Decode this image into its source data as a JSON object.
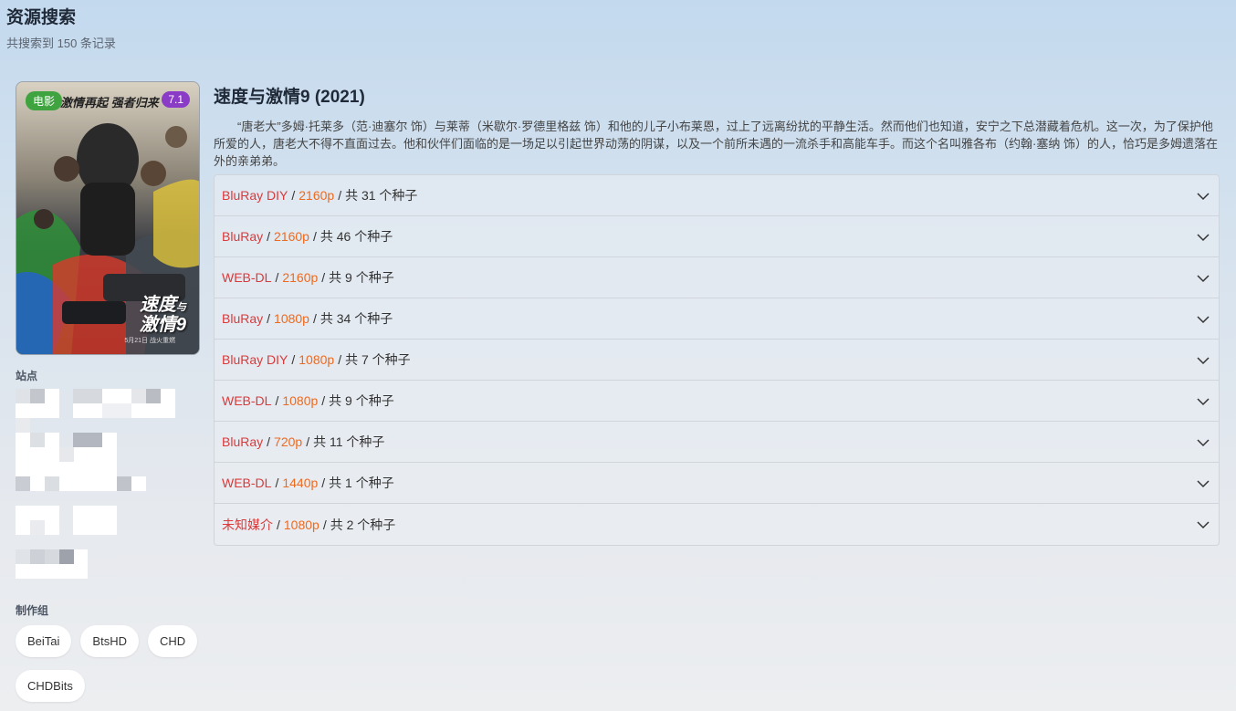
{
  "header": {
    "title": "资源搜索",
    "subtitle": "共搜索到 150 条记录"
  },
  "poster": {
    "type_badge": "电影",
    "rating": "7.1",
    "tagline": "激情再起 强者归来",
    "logo_line1": "速度",
    "logo_small": "与",
    "logo_line2": "激情9",
    "date_text": "5月21日 战火重燃"
  },
  "sidebar": {
    "site_label": "站点",
    "group_label": "制作组",
    "groups": [
      "BeiTai",
      "BtsHD",
      "CHD",
      "CHDBits"
    ]
  },
  "movie": {
    "title": "速度与激情9 (2021)",
    "overview": "“唐老大”多姆·托莱多（范·迪塞尔 饰）与莱蒂（米歇尔·罗德里格兹 饰）和他的儿子小布莱恩，过上了远离纷扰的平静生活。然而他们也知道，安宁之下总潜藏着危机。这一次，为了保护他所爱的人，唐老大不得不直面过去。他和伙伴们面临的是一场足以引起世界动荡的阴谋，以及一个前所未遇的一流杀手和高能车手。而这个名叫雅各布（约翰·塞纳 饰）的人，恰巧是多姆遗落在外的亲弟弟。"
  },
  "releases": [
    {
      "source": "BluRay DIY",
      "resolution": "2160p",
      "count": "共 31 个种子"
    },
    {
      "source": "BluRay",
      "resolution": "2160p",
      "count": "共 46 个种子"
    },
    {
      "source": "WEB-DL",
      "resolution": "2160p",
      "count": "共 9 个种子"
    },
    {
      "source": "BluRay",
      "resolution": "1080p",
      "count": "共 34 个种子"
    },
    {
      "source": "BluRay DIY",
      "resolution": "1080p",
      "count": "共 7 个种子"
    },
    {
      "source": "WEB-DL",
      "resolution": "1080p",
      "count": "共 9 个种子"
    },
    {
      "source": "BluRay",
      "resolution": "720p",
      "count": "共 11 个种子"
    },
    {
      "source": "WEB-DL",
      "resolution": "1440p",
      "count": "共 1 个种子"
    },
    {
      "source": "未知媒介",
      "resolution": "1080p",
      "count": "共 2 个种子"
    }
  ],
  "separator": "/",
  "colors": {
    "source": "#d93a3a",
    "resolution": "#ee6a1f",
    "type_badge": "#3fa33f",
    "rating_badge": "#8a3cc7"
  }
}
